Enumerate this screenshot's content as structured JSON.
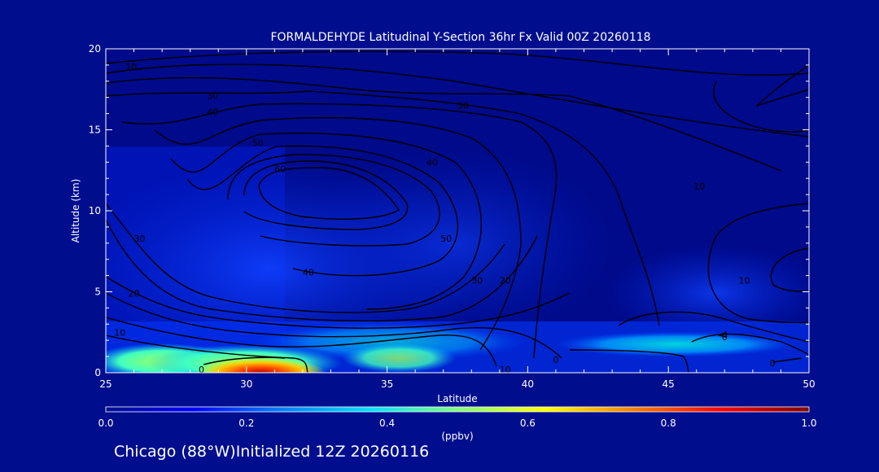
{
  "chart_data": {
    "type": "heatmap",
    "title": "FORMALDEHYDE Latitudinal Y-Section 36hr  Fx Valid 00Z 20260118",
    "xlabel": "Latitude",
    "ylabel": "Altitude (km)",
    "xlim": [
      25,
      50
    ],
    "ylim": [
      0,
      20
    ],
    "x_ticks": [
      "25",
      "30",
      "35",
      "40",
      "45",
      "50"
    ],
    "y_ticks": [
      "0",
      "5",
      "10",
      "15",
      "20"
    ],
    "colorbar": {
      "label": "(ppbv)",
      "range": [
        0.0,
        1.0
      ],
      "ticks": [
        "0.0",
        "0.2",
        "0.4",
        "0.6",
        "0.8",
        "1.0"
      ],
      "colors": [
        "#000e8e",
        "#0000ff",
        "#0080ff",
        "#00e0ff",
        "#80ff80",
        "#ffff00",
        "#ff8000",
        "#ff0000",
        "#800000"
      ]
    },
    "contour_labels": [
      {
        "text": "10",
        "lat": 25.9,
        "alt": 18.9
      },
      {
        "text": "30",
        "lat": 28.8,
        "alt": 17.1
      },
      {
        "text": "40",
        "lat": 28.8,
        "alt": 16.1
      },
      {
        "text": "30",
        "lat": 37.7,
        "alt": 16.5
      },
      {
        "text": "50",
        "lat": 30.4,
        "alt": 14.2
      },
      {
        "text": "60",
        "lat": 31.2,
        "alt": 12.6
      },
      {
        "text": "40",
        "lat": 36.6,
        "alt": 13.0
      },
      {
        "text": "10",
        "lat": 46.1,
        "alt": 11.5
      },
      {
        "text": "30",
        "lat": 26.2,
        "alt": 8.3
      },
      {
        "text": "50",
        "lat": 37.1,
        "alt": 8.3
      },
      {
        "text": "40",
        "lat": 32.2,
        "alt": 6.2
      },
      {
        "text": "30",
        "lat": 38.2,
        "alt": 5.7
      },
      {
        "text": "20",
        "lat": 39.2,
        "alt": 5.7
      },
      {
        "text": "10",
        "lat": 47.7,
        "alt": 5.7
      },
      {
        "text": "20",
        "lat": 26.0,
        "alt": 4.9
      },
      {
        "text": "10",
        "lat": 25.5,
        "alt": 2.5
      },
      {
        "text": "10",
        "lat": 39.2,
        "alt": 0.2
      },
      {
        "text": "0",
        "lat": 41.0,
        "alt": 0.8
      },
      {
        "text": "0",
        "lat": 28.4,
        "alt": 0.2
      },
      {
        "text": "0",
        "lat": 47.0,
        "alt": 2.2
      },
      {
        "text": "0",
        "lat": 48.7,
        "alt": 0.6
      }
    ],
    "footer": "Chicago (88°W)Initialized 12Z 20260116"
  }
}
